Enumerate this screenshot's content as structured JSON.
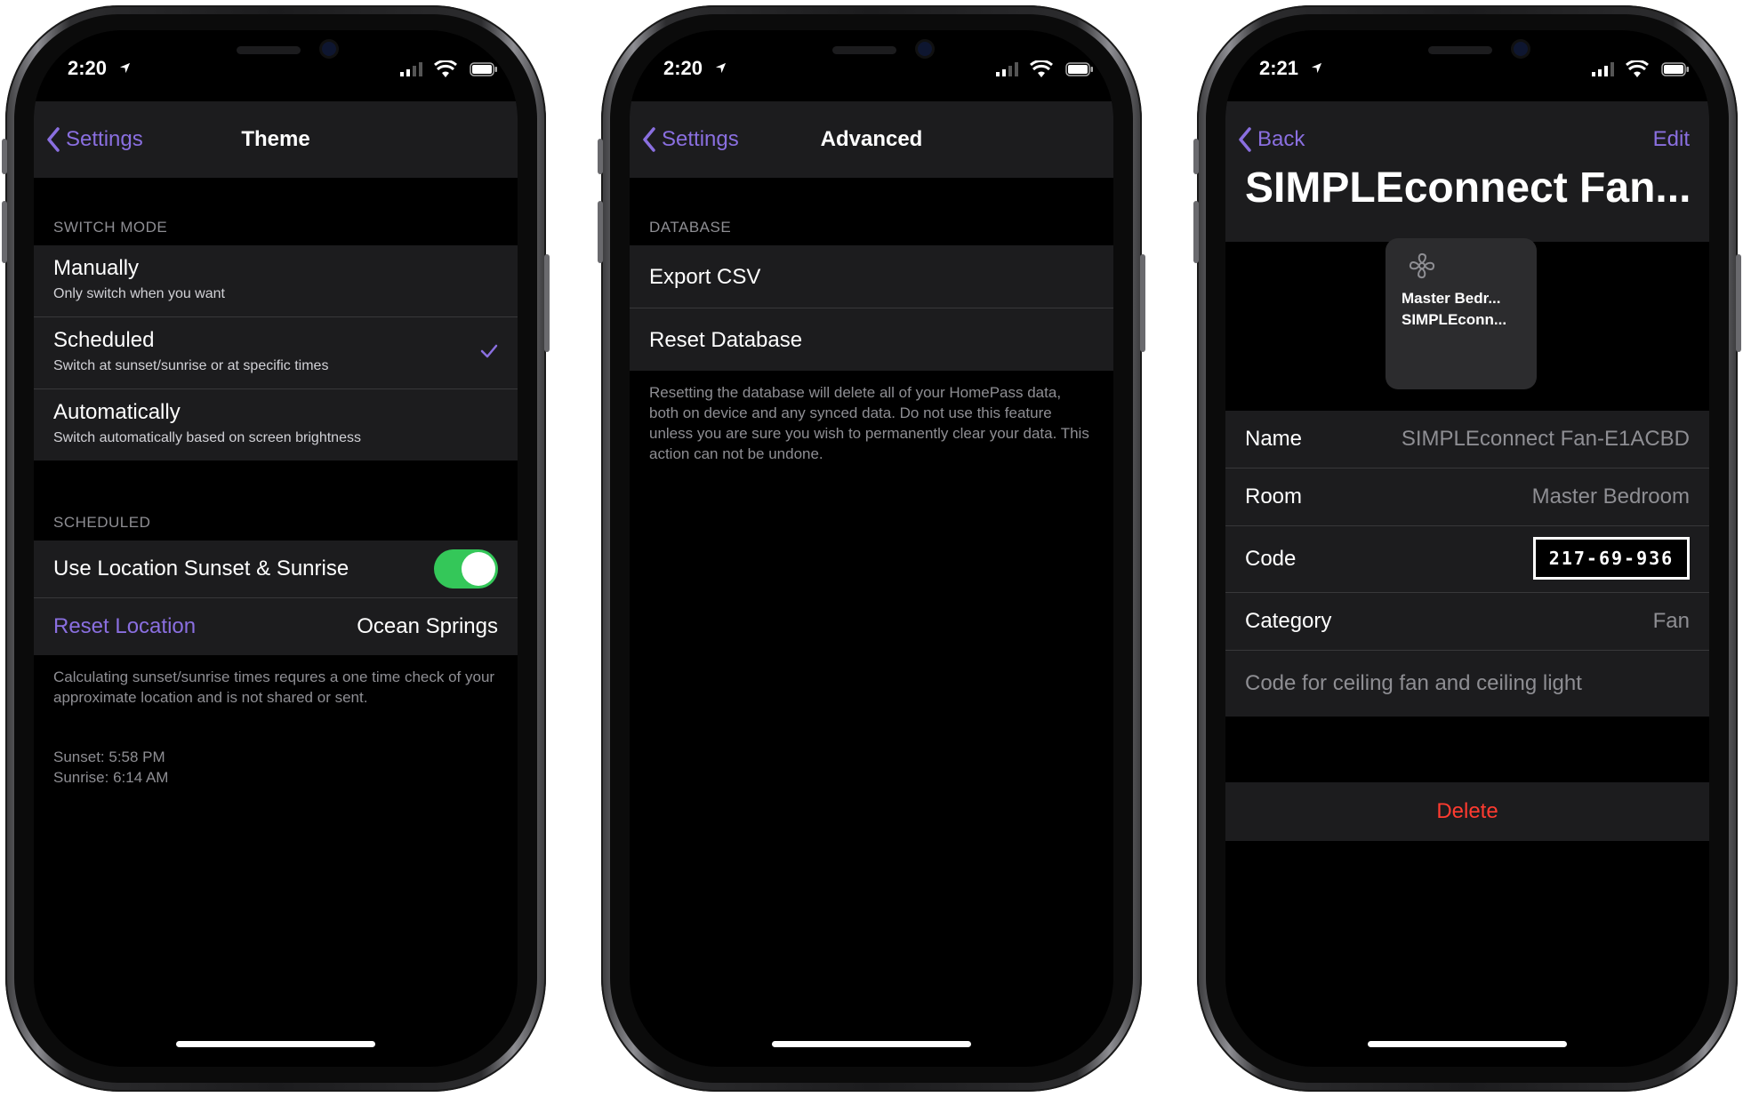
{
  "status": {
    "phone1_time": "2:20",
    "phone2_time": "2:20",
    "phone3_time": "2:21"
  },
  "colors": {
    "accent": "#8a6fe0",
    "toggle_on": "#34c759",
    "destructive": "#ff3b30",
    "cell_bg": "#1c1c1e"
  },
  "theme": {
    "back_label": "Settings",
    "title": "Theme",
    "switch_mode_header": "SWITCH MODE",
    "options": [
      {
        "title": "Manually",
        "subtitle": "Only switch when you want"
      },
      {
        "title": "Scheduled",
        "subtitle": "Switch at sunset/sunrise or at specific times",
        "selected": true
      },
      {
        "title": "Automatically",
        "subtitle": "Switch automatically based on screen brightness"
      }
    ],
    "scheduled_header": "SCHEDULED",
    "use_location_label": "Use Location Sunset & Sunrise",
    "use_location_on": true,
    "reset_location_label": "Reset Location",
    "location_value": "Ocean Springs",
    "footer_text": "Calculating sunset/sunrise times requres a one time check of your approximate location and is not shared or sent.",
    "sunset": "Sunset: 5:58 PM",
    "sunrise": "Sunrise: 6:14 AM"
  },
  "advanced": {
    "back_label": "Settings",
    "title": "Advanced",
    "database_header": "DATABASE",
    "export_label": "Export CSV",
    "reset_label": "Reset Database",
    "footer_text": "Resetting the database will delete all of your HomePass data, both on device and any synced data. Do not use this feature unless you are sure you wish to permanently clear your data. This action can not be undone."
  },
  "detail": {
    "back_label": "Back",
    "edit_label": "Edit",
    "large_title": "SIMPLEconnect Fan...",
    "tile_line1": "Master Bedr...",
    "tile_line2": "SIMPLEconn...",
    "name_key": "Name",
    "name_value": "SIMPLEconnect Fan-E1ACBD",
    "room_key": "Room",
    "room_value": "Master Bedroom",
    "code_key": "Code",
    "code_value": "217-69-936",
    "category_key": "Category",
    "category_value": "Fan",
    "notes": "Code for ceiling fan and ceiling light",
    "delete_label": "Delete"
  }
}
